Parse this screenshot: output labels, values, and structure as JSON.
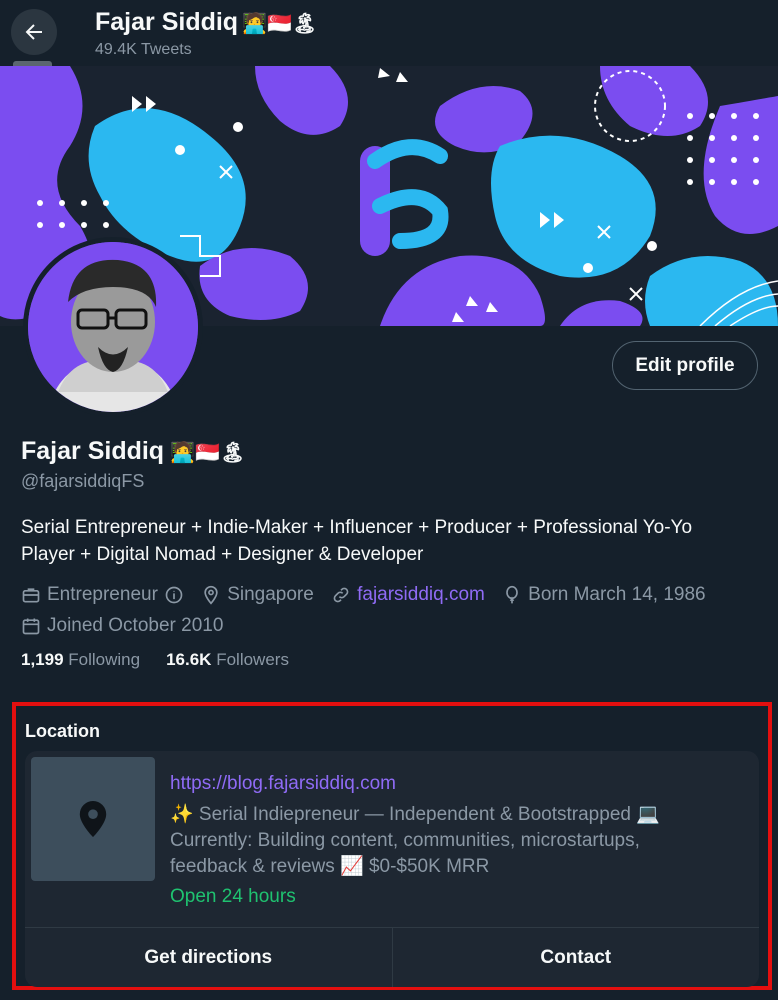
{
  "header": {
    "name": "Fajar Siddiq",
    "tweet_count": "49.4K Tweets",
    "back_tooltip": "Back"
  },
  "profile": {
    "name": "Fajar Siddiq",
    "handle": "@fajarsiddiqFS",
    "edit_button": "Edit profile",
    "bio_line1": "Serial Entrepreneur + Indie-Maker + Influencer + Producer + Professional Yo-Yo",
    "bio_line2": "Player + Digital Nomad + Designer & Developer",
    "category": "Entrepreneur",
    "location": "Singapore",
    "website": "fajarsiddiq.com",
    "birthday": "Born March 14, 1986",
    "joined": "Joined October 2010",
    "following_count": "1,199",
    "following_label": "Following",
    "followers_count": "16.6K",
    "followers_label": "Followers"
  },
  "location_module": {
    "title": "Location",
    "url": "https://blog.fajarsiddiq.com",
    "desc_line1": "✨ Serial Indiepreneur — Independent & Bootstrapped 💻",
    "desc_line2": "Currently: Building content, communities, microstartups,",
    "desc_line3": "feedback & reviews  📈 $0-$50K MRR",
    "hours": "Open 24 hours",
    "directions_button": "Get directions",
    "contact_button": "Contact"
  },
  "colors": {
    "background": "#15202b",
    "accent_link": "#8f6bf5",
    "muted_text": "#8b98a5",
    "open_status": "#1fc270",
    "highlight_border": "#e30f0f"
  }
}
